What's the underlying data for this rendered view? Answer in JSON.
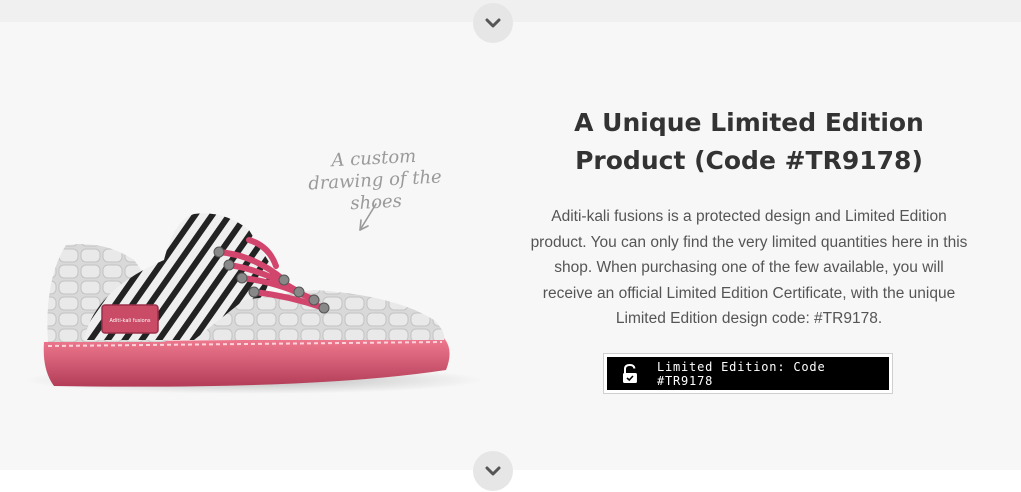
{
  "nav": {
    "scroll_up_icon": "chevron-down-icon",
    "scroll_down_icon": "chevron-down-icon"
  },
  "product": {
    "title": "A Unique Limited Edition Product (Code #TR9178)",
    "description": "Aditi-kali fusions is a protected design and Limited Edition product. You can only find the very limited quantities here in this shop. When purchasing one of the few available, you will receive an official Limited Edition Certificate, with the unique Limited Edition design code: #TR9178.",
    "image_alt": "Custom sneaker with zebra print and white crocodile leather, pink sole and laces",
    "shoe_label": "Aditi-kali fusions"
  },
  "annotation": {
    "text": "A custom drawing of the shoes"
  },
  "badge": {
    "label": "Limited Edition: Code #TR9178",
    "icon": "unlock-icon"
  },
  "colors": {
    "accent_pink": "#d2466e",
    "sole_pink": "#c94b66",
    "badge_bg": "#000000"
  }
}
